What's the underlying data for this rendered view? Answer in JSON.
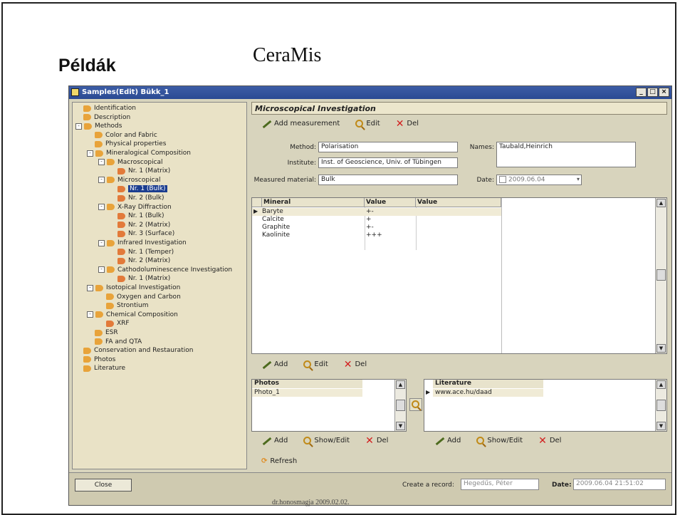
{
  "slide": {
    "title": "Példák",
    "subtitle": "CeraMis",
    "footer": "dr.honosmagja 2009.02.02."
  },
  "window": {
    "title": "Samples(Edit) Bükk_1",
    "minimize": "_",
    "maximize": "□",
    "close": "×"
  },
  "tree": [
    {
      "label": "Identification",
      "level": 1
    },
    {
      "label": "Description",
      "level": 1
    },
    {
      "label": "Methods",
      "level": 1,
      "toggle": "-"
    },
    {
      "label": "Color and Fabric",
      "level": 2
    },
    {
      "label": "Physical properties",
      "level": 2
    },
    {
      "label": "Mineralogical Composition",
      "level": 2,
      "toggle": "-"
    },
    {
      "label": "Macroscopical",
      "level": 3,
      "toggle": "-"
    },
    {
      "label": "Nr. 1 (Matrix)",
      "level": 4,
      "leaf": true
    },
    {
      "label": "Microscopical",
      "level": 3,
      "toggle": "-"
    },
    {
      "label": "Nr. 1 (Bulk)",
      "level": 4,
      "leaf": true,
      "selected": true
    },
    {
      "label": "Nr. 2 (Bulk)",
      "level": 4,
      "leaf": true
    },
    {
      "label": "X-Ray Diffraction",
      "level": 3,
      "toggle": "-"
    },
    {
      "label": "Nr. 1 (Bulk)",
      "level": 4,
      "leaf": true
    },
    {
      "label": "Nr. 2 (Matrix)",
      "level": 4,
      "leaf": true
    },
    {
      "label": "Nr. 3 (Surface)",
      "level": 4,
      "leaf": true
    },
    {
      "label": "Infrared Investigation",
      "level": 3,
      "toggle": "-"
    },
    {
      "label": "Nr. 1 (Temper)",
      "level": 4,
      "leaf": true
    },
    {
      "label": "Nr. 2 (Matrix)",
      "level": 4,
      "leaf": true
    },
    {
      "label": "Cathodoluminescence Investigation",
      "level": 3,
      "toggle": "-"
    },
    {
      "label": "Nr. 1 (Matrix)",
      "level": 4,
      "leaf": true
    },
    {
      "label": "Isotopical Investigation",
      "level": 2,
      "toggle": "-"
    },
    {
      "label": "Oxygen and Carbon",
      "level": 3
    },
    {
      "label": "Strontium",
      "level": 3
    },
    {
      "label": "Chemical Composition",
      "level": 2,
      "toggle": "-"
    },
    {
      "label": "XRF",
      "level": 3,
      "leaf": true
    },
    {
      "label": "ESR",
      "level": 2
    },
    {
      "label": "FA and QTA",
      "level": 2
    },
    {
      "label": "Conservation and Restauration",
      "level": 1
    },
    {
      "label": "Photos",
      "level": 1
    },
    {
      "label": "Literature",
      "level": 1
    }
  ],
  "panel": {
    "title": "Microscopical Investigation",
    "toolbar": {
      "add": "Add measurement",
      "edit": "Edit",
      "del": "Del"
    },
    "form": {
      "method_label": "Method:",
      "method_value": "Polarisation",
      "institute_label": "Institute:",
      "institute_value": "Inst. of Geoscience, Univ. of Tübingen",
      "material_label": "Measured material:",
      "material_value": "Bulk",
      "names_label": "Names:",
      "names_value": "Taubald,Heinrich",
      "date_label": "Date:",
      "date_value": "2009.06.04"
    },
    "grid": {
      "columns": [
        "Mineral",
        "Value",
        "Value"
      ],
      "rows": [
        {
          "mineral": "Baryte",
          "value": "+-",
          "value2": ""
        },
        {
          "mineral": "Calcite",
          "value": "+",
          "value2": ""
        },
        {
          "mineral": "Graphite",
          "value": "+-",
          "value2": ""
        },
        {
          "mineral": "Kaolinite",
          "value": "+++",
          "value2": ""
        }
      ]
    },
    "grid_toolbar": {
      "add": "Add",
      "edit": "Edit",
      "del": "Del"
    },
    "photos": {
      "header": "Photos",
      "rows": [
        "Photo_1"
      ]
    },
    "literature": {
      "header": "Literature",
      "rows": [
        "www.ace.hu/daad"
      ]
    },
    "photos_toolbar": {
      "add": "Add",
      "show": "Show/Edit",
      "del": "Del"
    },
    "lit_toolbar": {
      "add": "Add",
      "show": "Show/Edit",
      "del": "Del"
    },
    "refresh": "Refresh"
  },
  "status": {
    "close": "Close",
    "create_label": "Create a record:",
    "create_value": "Hegedűs, Péter",
    "date_label": "Date:",
    "date_value": "2009.06.04 21:51:02"
  },
  "colors": {
    "titlebar": "#2a4a93",
    "selected": "#1b3d8f",
    "folder_icon": "#e8a33a",
    "leaf_icon": "#e27a3a"
  }
}
